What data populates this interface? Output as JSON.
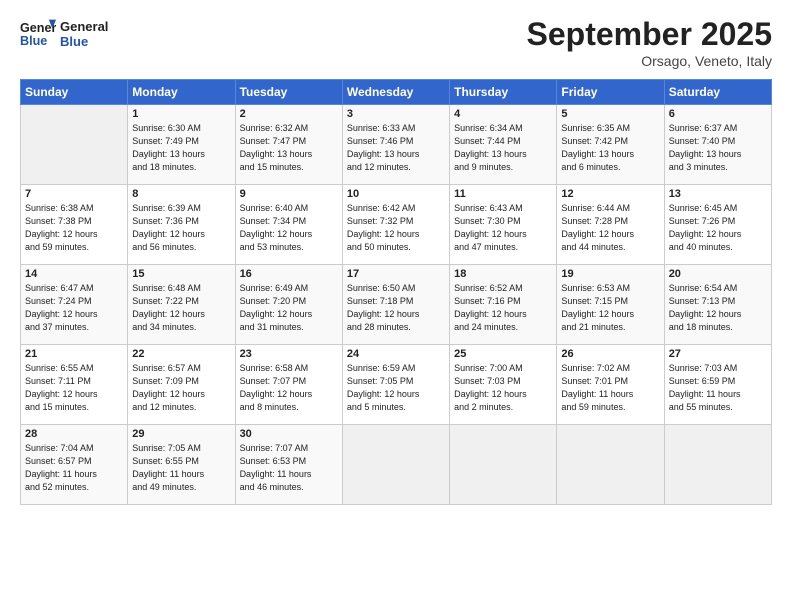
{
  "header": {
    "logo_line1": "General",
    "logo_line2": "Blue",
    "month": "September 2025",
    "location": "Orsago, Veneto, Italy"
  },
  "days_of_week": [
    "Sunday",
    "Monday",
    "Tuesday",
    "Wednesday",
    "Thursday",
    "Friday",
    "Saturday"
  ],
  "weeks": [
    [
      {
        "day": "",
        "info": ""
      },
      {
        "day": "1",
        "info": "Sunrise: 6:30 AM\nSunset: 7:49 PM\nDaylight: 13 hours\nand 18 minutes."
      },
      {
        "day": "2",
        "info": "Sunrise: 6:32 AM\nSunset: 7:47 PM\nDaylight: 13 hours\nand 15 minutes."
      },
      {
        "day": "3",
        "info": "Sunrise: 6:33 AM\nSunset: 7:46 PM\nDaylight: 13 hours\nand 12 minutes."
      },
      {
        "day": "4",
        "info": "Sunrise: 6:34 AM\nSunset: 7:44 PM\nDaylight: 13 hours\nand 9 minutes."
      },
      {
        "day": "5",
        "info": "Sunrise: 6:35 AM\nSunset: 7:42 PM\nDaylight: 13 hours\nand 6 minutes."
      },
      {
        "day": "6",
        "info": "Sunrise: 6:37 AM\nSunset: 7:40 PM\nDaylight: 13 hours\nand 3 minutes."
      }
    ],
    [
      {
        "day": "7",
        "info": "Sunrise: 6:38 AM\nSunset: 7:38 PM\nDaylight: 12 hours\nand 59 minutes."
      },
      {
        "day": "8",
        "info": "Sunrise: 6:39 AM\nSunset: 7:36 PM\nDaylight: 12 hours\nand 56 minutes."
      },
      {
        "day": "9",
        "info": "Sunrise: 6:40 AM\nSunset: 7:34 PM\nDaylight: 12 hours\nand 53 minutes."
      },
      {
        "day": "10",
        "info": "Sunrise: 6:42 AM\nSunset: 7:32 PM\nDaylight: 12 hours\nand 50 minutes."
      },
      {
        "day": "11",
        "info": "Sunrise: 6:43 AM\nSunset: 7:30 PM\nDaylight: 12 hours\nand 47 minutes."
      },
      {
        "day": "12",
        "info": "Sunrise: 6:44 AM\nSunset: 7:28 PM\nDaylight: 12 hours\nand 44 minutes."
      },
      {
        "day": "13",
        "info": "Sunrise: 6:45 AM\nSunset: 7:26 PM\nDaylight: 12 hours\nand 40 minutes."
      }
    ],
    [
      {
        "day": "14",
        "info": "Sunrise: 6:47 AM\nSunset: 7:24 PM\nDaylight: 12 hours\nand 37 minutes."
      },
      {
        "day": "15",
        "info": "Sunrise: 6:48 AM\nSunset: 7:22 PM\nDaylight: 12 hours\nand 34 minutes."
      },
      {
        "day": "16",
        "info": "Sunrise: 6:49 AM\nSunset: 7:20 PM\nDaylight: 12 hours\nand 31 minutes."
      },
      {
        "day": "17",
        "info": "Sunrise: 6:50 AM\nSunset: 7:18 PM\nDaylight: 12 hours\nand 28 minutes."
      },
      {
        "day": "18",
        "info": "Sunrise: 6:52 AM\nSunset: 7:16 PM\nDaylight: 12 hours\nand 24 minutes."
      },
      {
        "day": "19",
        "info": "Sunrise: 6:53 AM\nSunset: 7:15 PM\nDaylight: 12 hours\nand 21 minutes."
      },
      {
        "day": "20",
        "info": "Sunrise: 6:54 AM\nSunset: 7:13 PM\nDaylight: 12 hours\nand 18 minutes."
      }
    ],
    [
      {
        "day": "21",
        "info": "Sunrise: 6:55 AM\nSunset: 7:11 PM\nDaylight: 12 hours\nand 15 minutes."
      },
      {
        "day": "22",
        "info": "Sunrise: 6:57 AM\nSunset: 7:09 PM\nDaylight: 12 hours\nand 12 minutes."
      },
      {
        "day": "23",
        "info": "Sunrise: 6:58 AM\nSunset: 7:07 PM\nDaylight: 12 hours\nand 8 minutes."
      },
      {
        "day": "24",
        "info": "Sunrise: 6:59 AM\nSunset: 7:05 PM\nDaylight: 12 hours\nand 5 minutes."
      },
      {
        "day": "25",
        "info": "Sunrise: 7:00 AM\nSunset: 7:03 PM\nDaylight: 12 hours\nand 2 minutes."
      },
      {
        "day": "26",
        "info": "Sunrise: 7:02 AM\nSunset: 7:01 PM\nDaylight: 11 hours\nand 59 minutes."
      },
      {
        "day": "27",
        "info": "Sunrise: 7:03 AM\nSunset: 6:59 PM\nDaylight: 11 hours\nand 55 minutes."
      }
    ],
    [
      {
        "day": "28",
        "info": "Sunrise: 7:04 AM\nSunset: 6:57 PM\nDaylight: 11 hours\nand 52 minutes."
      },
      {
        "day": "29",
        "info": "Sunrise: 7:05 AM\nSunset: 6:55 PM\nDaylight: 11 hours\nand 49 minutes."
      },
      {
        "day": "30",
        "info": "Sunrise: 7:07 AM\nSunset: 6:53 PM\nDaylight: 11 hours\nand 46 minutes."
      },
      {
        "day": "",
        "info": ""
      },
      {
        "day": "",
        "info": ""
      },
      {
        "day": "",
        "info": ""
      },
      {
        "day": "",
        "info": ""
      }
    ]
  ]
}
